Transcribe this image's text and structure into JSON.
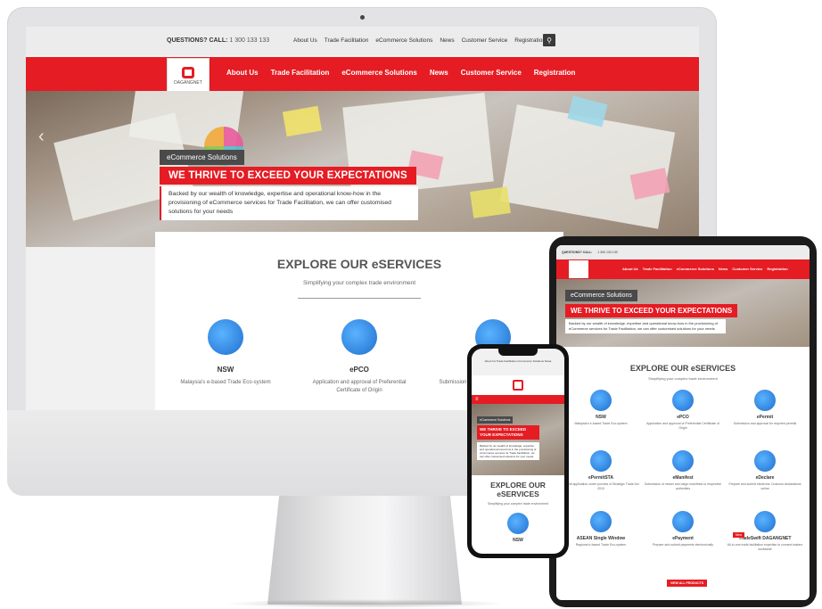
{
  "site": {
    "phone_label": "QUESTIONS? CALL:",
    "phone_number": "1 300 133 133",
    "top_links": [
      "About Us",
      "Trade Facilitation",
      "eCommerce Solutions",
      "News",
      "Customer Service",
      "Registration"
    ],
    "nav_links": [
      "About Us",
      "Trade Facilitation",
      "eCommerce Solutions",
      "News",
      "Customer Service",
      "Registration"
    ],
    "logo_text": "DAGANGNET",
    "hero": {
      "category": "eCommerce Solutions",
      "title": "WE THRIVE TO EXCEED YOUR EXPECTATIONS",
      "body": "Backed by our wealth of knowledge, expertise and operational know-how in the provisioning of eCommerce services for Trade Facilitation, we can offer customised solutions for your needs"
    },
    "explore": {
      "title": "EXPLORE OUR eSERVICES",
      "subtitle": "Simplifying your complex trade environment",
      "services": [
        {
          "name": "NSW",
          "desc": "Malaysia's e-based Trade Eco-system"
        },
        {
          "name": "ePCO",
          "desc": "Application and approval of Preferential Certificate of Origin"
        },
        {
          "name": "ePermit",
          "desc": "Submission and approval for required permits"
        }
      ]
    }
  },
  "tablet": {
    "cells": [
      {
        "name": "NSW",
        "desc": "Malaysia's e-based Trade Eco-system"
      },
      {
        "name": "ePCO",
        "desc": "Application and approval of Preferential Certificate of Origin"
      },
      {
        "name": "ePermit",
        "desc": "Submission and approval for required permits"
      },
      {
        "name": "ePermitSTA",
        "desc": "Permit application under purview of Strategic Trade Act 2010"
      },
      {
        "name": "eManifest",
        "desc": "Submission of vessel and cargo manifests to respective authorities"
      },
      {
        "name": "eDeclare",
        "desc": "Prepare and submit electronic Customs declarations online"
      },
      {
        "name": "ASEAN Single Window",
        "desc": "Regional e-based Trade Eco-system"
      },
      {
        "name": "ePayment",
        "desc": "Prepare and submit payments electronically"
      },
      {
        "name": "TradeSwift DAGANGNET",
        "desc": "All-in-one trade facilitation expertise to connect traders worldwide"
      }
    ],
    "button": "VIEW ALL PRODUCTS",
    "new_badge": "New"
  },
  "phone": {
    "explore_title": "EXPLORE OUR eSERVICES",
    "subtitle": "Simplifying your complex trade environment",
    "first_service": "NSW",
    "menu_glyph": "≡"
  }
}
